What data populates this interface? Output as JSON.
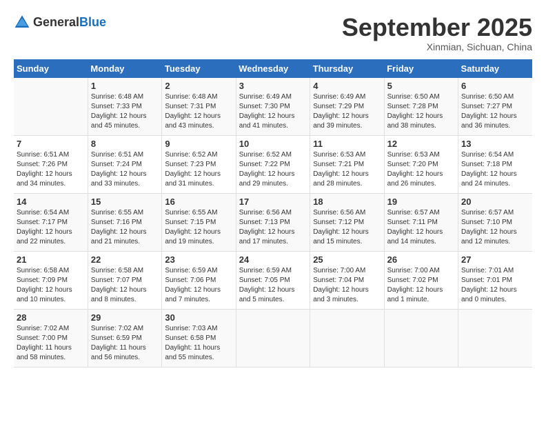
{
  "logo": {
    "general": "General",
    "blue": "Blue"
  },
  "header": {
    "month": "September 2025",
    "location": "Xinmian, Sichuan, China"
  },
  "days_of_week": [
    "Sunday",
    "Monday",
    "Tuesday",
    "Wednesday",
    "Thursday",
    "Friday",
    "Saturday"
  ],
  "weeks": [
    [
      {
        "day": null
      },
      {
        "day": "1",
        "sunrise": "6:48 AM",
        "sunset": "7:33 PM",
        "daylight": "12 hours and 45 minutes."
      },
      {
        "day": "2",
        "sunrise": "6:48 AM",
        "sunset": "7:31 PM",
        "daylight": "12 hours and 43 minutes."
      },
      {
        "day": "3",
        "sunrise": "6:49 AM",
        "sunset": "7:30 PM",
        "daylight": "12 hours and 41 minutes."
      },
      {
        "day": "4",
        "sunrise": "6:49 AM",
        "sunset": "7:29 PM",
        "daylight": "12 hours and 39 minutes."
      },
      {
        "day": "5",
        "sunrise": "6:50 AM",
        "sunset": "7:28 PM",
        "daylight": "12 hours and 38 minutes."
      },
      {
        "day": "6",
        "sunrise": "6:50 AM",
        "sunset": "7:27 PM",
        "daylight": "12 hours and 36 minutes."
      }
    ],
    [
      {
        "day": "7",
        "sunrise": "6:51 AM",
        "sunset": "7:26 PM",
        "daylight": "12 hours and 34 minutes."
      },
      {
        "day": "8",
        "sunrise": "6:51 AM",
        "sunset": "7:24 PM",
        "daylight": "12 hours and 33 minutes."
      },
      {
        "day": "9",
        "sunrise": "6:52 AM",
        "sunset": "7:23 PM",
        "daylight": "12 hours and 31 minutes."
      },
      {
        "day": "10",
        "sunrise": "6:52 AM",
        "sunset": "7:22 PM",
        "daylight": "12 hours and 29 minutes."
      },
      {
        "day": "11",
        "sunrise": "6:53 AM",
        "sunset": "7:21 PM",
        "daylight": "12 hours and 28 minutes."
      },
      {
        "day": "12",
        "sunrise": "6:53 AM",
        "sunset": "7:20 PM",
        "daylight": "12 hours and 26 minutes."
      },
      {
        "day": "13",
        "sunrise": "6:54 AM",
        "sunset": "7:18 PM",
        "daylight": "12 hours and 24 minutes."
      }
    ],
    [
      {
        "day": "14",
        "sunrise": "6:54 AM",
        "sunset": "7:17 PM",
        "daylight": "12 hours and 22 minutes."
      },
      {
        "day": "15",
        "sunrise": "6:55 AM",
        "sunset": "7:16 PM",
        "daylight": "12 hours and 21 minutes."
      },
      {
        "day": "16",
        "sunrise": "6:55 AM",
        "sunset": "7:15 PM",
        "daylight": "12 hours and 19 minutes."
      },
      {
        "day": "17",
        "sunrise": "6:56 AM",
        "sunset": "7:13 PM",
        "daylight": "12 hours and 17 minutes."
      },
      {
        "day": "18",
        "sunrise": "6:56 AM",
        "sunset": "7:12 PM",
        "daylight": "12 hours and 15 minutes."
      },
      {
        "day": "19",
        "sunrise": "6:57 AM",
        "sunset": "7:11 PM",
        "daylight": "12 hours and 14 minutes."
      },
      {
        "day": "20",
        "sunrise": "6:57 AM",
        "sunset": "7:10 PM",
        "daylight": "12 hours and 12 minutes."
      }
    ],
    [
      {
        "day": "21",
        "sunrise": "6:58 AM",
        "sunset": "7:09 PM",
        "daylight": "12 hours and 10 minutes."
      },
      {
        "day": "22",
        "sunrise": "6:58 AM",
        "sunset": "7:07 PM",
        "daylight": "12 hours and 8 minutes."
      },
      {
        "day": "23",
        "sunrise": "6:59 AM",
        "sunset": "7:06 PM",
        "daylight": "12 hours and 7 minutes."
      },
      {
        "day": "24",
        "sunrise": "6:59 AM",
        "sunset": "7:05 PM",
        "daylight": "12 hours and 5 minutes."
      },
      {
        "day": "25",
        "sunrise": "7:00 AM",
        "sunset": "7:04 PM",
        "daylight": "12 hours and 3 minutes."
      },
      {
        "day": "26",
        "sunrise": "7:00 AM",
        "sunset": "7:02 PM",
        "daylight": "12 hours and 1 minute."
      },
      {
        "day": "27",
        "sunrise": "7:01 AM",
        "sunset": "7:01 PM",
        "daylight": "12 hours and 0 minutes."
      }
    ],
    [
      {
        "day": "28",
        "sunrise": "7:02 AM",
        "sunset": "7:00 PM",
        "daylight": "11 hours and 58 minutes."
      },
      {
        "day": "29",
        "sunrise": "7:02 AM",
        "sunset": "6:59 PM",
        "daylight": "11 hours and 56 minutes."
      },
      {
        "day": "30",
        "sunrise": "7:03 AM",
        "sunset": "6:58 PM",
        "daylight": "11 hours and 55 minutes."
      },
      {
        "day": null
      },
      {
        "day": null
      },
      {
        "day": null
      },
      {
        "day": null
      }
    ]
  ],
  "labels": {
    "sunrise": "Sunrise:",
    "sunset": "Sunset:",
    "daylight": "Daylight:"
  }
}
